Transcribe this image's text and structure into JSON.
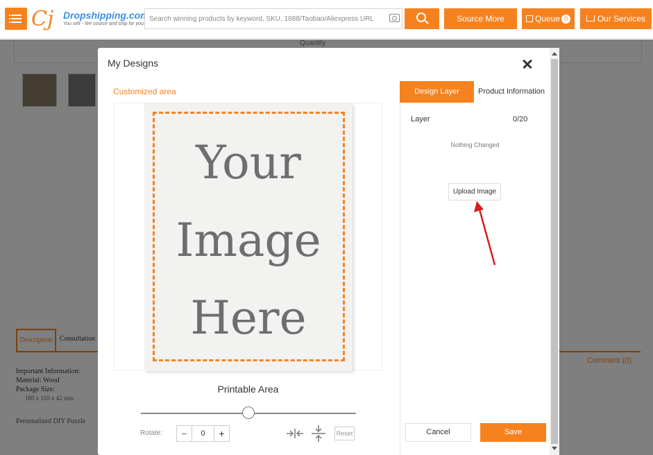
{
  "header": {
    "logo": {
      "mark": "Cj",
      "name": "Dropshipping.com",
      "tagline": "You sell - We source and ship for you!"
    },
    "search_placeholder": "Search winning products by keyword, SKU, 1688/Taobao/Aliexpress URL",
    "source_more": "Source More",
    "queue_label": "Queue",
    "queue_count": "0",
    "our_services": "Our Services"
  },
  "background": {
    "quantity_label": "Quantity",
    "tab_description": "Description",
    "tab_consultation": "Consultation",
    "info_important": "Important Information:",
    "info_material": "Material: Wood",
    "info_package": "Package Size:",
    "info_size": "180 x 110 x 42 mm",
    "puzzle_text": "Personalized DIY Puzzle",
    "comment": "Comment (0)"
  },
  "modal": {
    "title": "My Designs",
    "customized_area": "Customized area",
    "placeholder_lines": [
      "Your",
      "Image",
      "Here"
    ],
    "printable_area": "Printable Area",
    "slider_value": 0.5,
    "rotate_label": "Rotate:",
    "rotate_minus": "−",
    "rotate_value": "0",
    "rotate_plus": "+",
    "reset": "Reset",
    "tabs": {
      "design_layer": "Design Layer",
      "product_information": "Product Information"
    },
    "layer_label": "Layer",
    "layer_count": "0/20",
    "nothing_changed": "Nothing Changed",
    "upload_image": "Upload Image",
    "cancel": "Cancel",
    "save": "Save"
  },
  "colors": {
    "accent": "#f6821f",
    "link_blue": "#3a8ee6",
    "arrow_red": "#d42020"
  }
}
